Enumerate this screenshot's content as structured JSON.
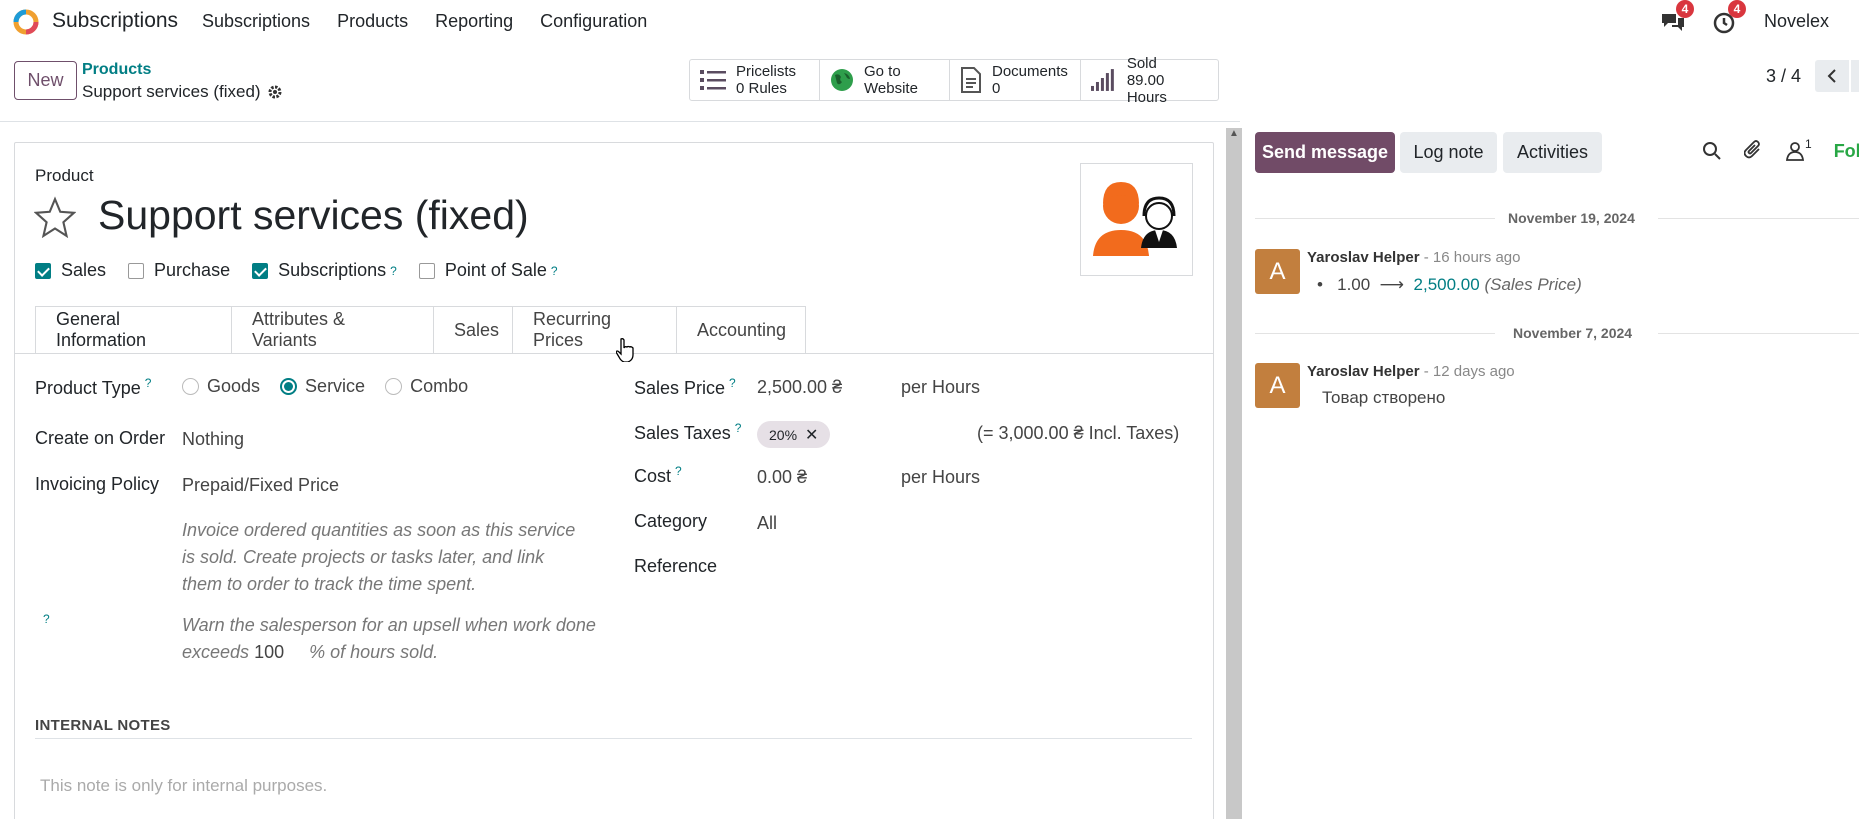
{
  "nav": {
    "app_name": "Subscriptions",
    "menu": [
      "Subscriptions",
      "Products",
      "Reporting",
      "Configuration"
    ],
    "messages_badge": "4",
    "activities_badge": "4",
    "company": "Novelex"
  },
  "control": {
    "new_label": "New",
    "breadcrumb_parent": "Products",
    "breadcrumb_current": "Support services (fixed)",
    "pager": "3 / 4"
  },
  "smart_buttons": [
    {
      "line1": "Pricelists",
      "line2": "0 Rules"
    },
    {
      "line1": "Go to",
      "line2": "Website"
    },
    {
      "line1": "Documents",
      "line2": "0"
    },
    {
      "line1": "Sold",
      "line2": "89.00 Hours"
    }
  ],
  "form": {
    "small_label": "Product",
    "name": "Support services (fixed)",
    "checks": [
      {
        "label": "Sales",
        "checked": true
      },
      {
        "label": "Purchase",
        "checked": false
      },
      {
        "label": "Subscriptions",
        "checked": true
      },
      {
        "label": "Point of Sale",
        "checked": false
      }
    ],
    "help_mark": "?",
    "tabs": [
      "General Information",
      "Attributes & Variants",
      "Sales",
      "Recurring Prices",
      "Accounting"
    ],
    "product_type_label": "Product Type",
    "product_type_options": [
      "Goods",
      "Service",
      "Combo"
    ],
    "create_on_order_label": "Create on Order",
    "create_on_order_value": "Nothing",
    "invoicing_policy_label": "Invoicing Policy",
    "invoicing_policy_value": "Prepaid/Fixed Price",
    "invoicing_help": "Invoice ordered quantities as soon as this service is sold. Create projects or tasks later, and link them to order to track the time spent.",
    "upsell_help_1": "Warn the salesperson for an upsell when work done",
    "upsell_help_2": "exceeds",
    "upsell_value": "100",
    "upsell_help_3": "% of hours sold.",
    "sales_price_label": "Sales Price",
    "sales_price_value": "2,500.00 ₴",
    "per_hours": "per Hours",
    "sales_taxes_label": "Sales Taxes",
    "tax_tag": "20%",
    "incl_taxes": "(= 3,000.00 ₴ Incl. Taxes)",
    "cost_label": "Cost",
    "cost_value": "0.00 ₴",
    "category_label": "Category",
    "category_value": "All",
    "reference_label": "Reference",
    "internal_notes_title": "INTERNAL NOTES",
    "internal_notes_placeholder": "This note is only for internal purposes."
  },
  "chatter": {
    "send_message": "Send message",
    "log_note": "Log note",
    "activities": "Activities",
    "followers_count": "1",
    "follow_label": "Follow",
    "date1": "November 19, 2024",
    "msg1_author": "Yaroslav Helper",
    "msg1_ago": "- 16 hours ago",
    "msg1_old": "1.00",
    "msg1_new": "2,500.00",
    "msg1_field": "(Sales Price)",
    "date2": "November 7, 2024",
    "msg2_author": "Yaroslav Helper",
    "msg2_ago": "- 12 days ago",
    "msg2_text": "Товар створено",
    "avatar_letter": "A"
  },
  "colors": {
    "brand": "#714b67",
    "teal": "#017e84",
    "avatar": "#c27f3e"
  }
}
